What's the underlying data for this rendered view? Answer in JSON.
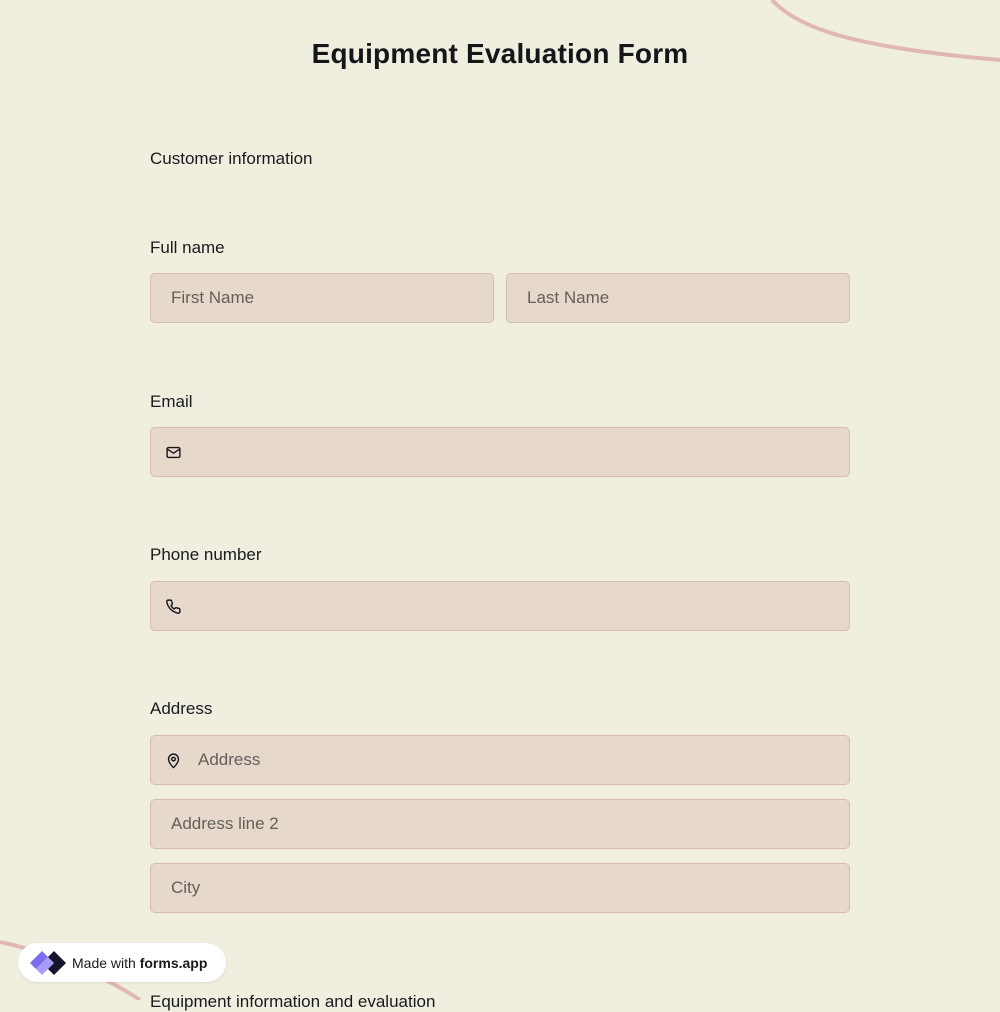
{
  "form": {
    "title": "Equipment Evaluation Form",
    "section_heading": "Customer information",
    "next_section_heading": "Equipment information and evaluation"
  },
  "fields": {
    "full_name": {
      "label": "Full name",
      "first_placeholder": "First Name",
      "last_placeholder": "Last Name"
    },
    "email": {
      "label": "Email",
      "placeholder": "",
      "icon": "envelope-icon"
    },
    "phone": {
      "label": "Phone number",
      "placeholder": "",
      "icon": "phone-icon"
    },
    "address": {
      "label": "Address",
      "line1_placeholder": "Address",
      "line2_placeholder": "Address line 2",
      "city_placeholder": "City",
      "icon": "map-pin-icon"
    }
  },
  "badge": {
    "prefix": "Made with",
    "brand": "forms.app"
  },
  "colors": {
    "background": "#f0eedf",
    "field_fill": "#e6d9cc",
    "field_border": "#d6b9af",
    "decor_curve": "#dfb8b5",
    "brand_purple": "#7c6cf0"
  }
}
